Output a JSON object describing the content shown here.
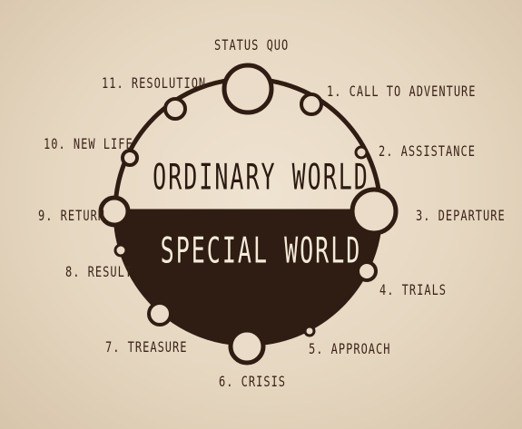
{
  "diagram": {
    "top_label": "ORDINARY WORLD",
    "bottom_label": "SPECIAL WORLD",
    "stages": {
      "status_quo": "STATUS QUO",
      "s1": "1. CALL TO ADVENTURE",
      "s2": "2. ASSISTANCE",
      "s3": "3. DEPARTURE",
      "s4": "4. TRIALS",
      "s5": "5. APPROACH",
      "s6": "6. CRISIS",
      "s7": "7. TREASURE",
      "s8": "8. RESULT",
      "s9": "9. RETURN",
      "s10": "10. NEW LIFE",
      "s11": "11. RESOLUTION"
    },
    "colors": {
      "ink": "#2f1c12",
      "paper": "#eadcc8"
    }
  }
}
